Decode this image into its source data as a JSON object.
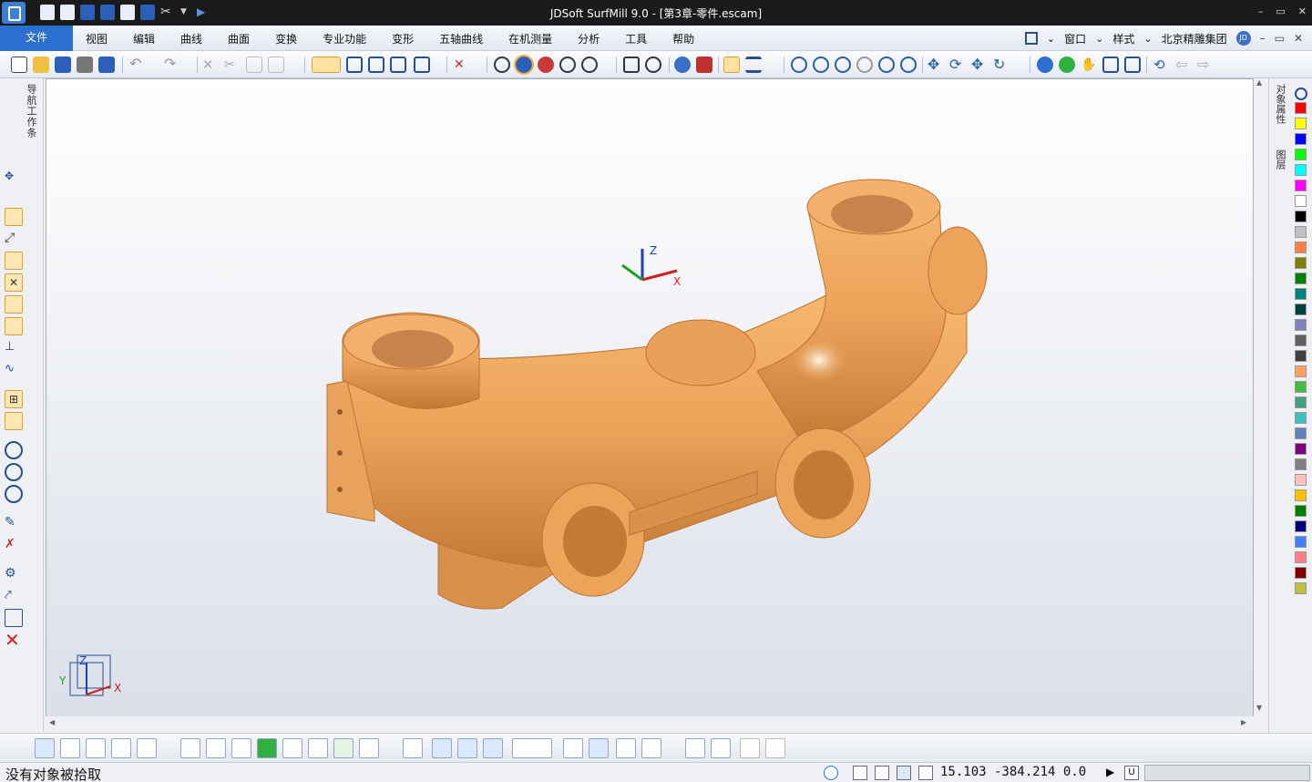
{
  "window": {
    "title": "JDSoft SurfMill 9.0 - [第3章-零件.escam]",
    "minimize": "–",
    "restore": "▭",
    "close": "✕"
  },
  "menu": {
    "file": "文件",
    "items": [
      "视图",
      "编辑",
      "曲线",
      "曲面",
      "变换",
      "专业功能",
      "变形",
      "五轴曲线",
      "在机测量",
      "分析",
      "工具",
      "帮助"
    ],
    "right": {
      "window": "窗口",
      "style": "样式",
      "company": "北京精雕集团",
      "badge": "JD"
    }
  },
  "left_panel": {
    "nav_label": "导航工作条"
  },
  "right_panel": {
    "properties_label": "对象属性",
    "layers_label": "图层",
    "palette": [
      "#ff0000",
      "#ffff00",
      "#0000ff",
      "#00ff00",
      "#00ffff",
      "#ff00ff",
      "#ffffff",
      "#000000",
      "#c0c0c0",
      "#ff8040",
      "#808000",
      "#008000",
      "#008080",
      "#004040",
      "#8080c0",
      "#606060",
      "#404040",
      "#ffa060",
      "#40c040",
      "#40a080",
      "#40c0c0",
      "#6080c0",
      "#800080",
      "#808080",
      "#ffc0c0",
      "#ffc000",
      "#008000",
      "#000080",
      "#4080ff",
      "#ff8080",
      "#800000",
      "#c0c040"
    ]
  },
  "viewport": {
    "axis_labels": {
      "x": "X",
      "y": "Y",
      "z": "Z"
    },
    "part_color": "#f0a860"
  },
  "status": {
    "message": "没有对象被拾取",
    "coordinates": "15.103 -384.214 0.0",
    "u_label": "U"
  }
}
